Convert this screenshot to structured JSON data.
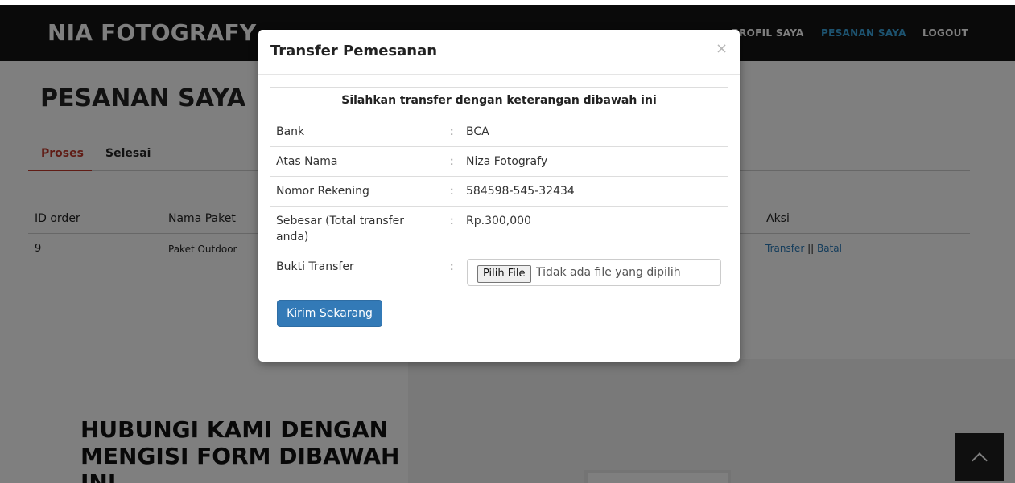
{
  "navbar": {
    "brand": "NIA FOTOGRAFY",
    "items": [
      "PROFIL SAYA",
      "PESANAN SAYA",
      "LOGOUT"
    ],
    "active_color": "#3aa6e0"
  },
  "page": {
    "title": "PESANAN SAYA",
    "tabs": [
      "Proses",
      "Selesai"
    ],
    "table": {
      "headers": [
        "ID order",
        "Nama Paket",
        "Aksi"
      ],
      "rows": [
        {
          "id": "9",
          "package": "Paket Outdoor",
          "action_transfer": "Transfer",
          "action_sep": "||",
          "action_cancel": "Batal"
        }
      ]
    }
  },
  "contact": {
    "title": "HUBUNGI KAMI DENGAN MENGISI FORM DIBAWAH INI"
  },
  "modal": {
    "title": "Transfer Pemesanan",
    "close": "×",
    "heading": "Silahkan transfer dengan keterangan dibawah ini",
    "rows": [
      {
        "label": "Bank",
        "value": "BCA"
      },
      {
        "label": "Atas Nama",
        "value": "Niza Fotografy"
      },
      {
        "label": "Nomor Rekening",
        "value": "584598-545-32434"
      },
      {
        "label": "Sebesar (Total transfer anda)",
        "value": "Rp.300,000"
      },
      {
        "label": "Bukti Transfer",
        "value": ""
      }
    ],
    "colon": ":",
    "file_button": "Pilih File",
    "file_status": "Tidak ada file yang dipilih",
    "submit": "Kirim Sekarang",
    "accent": "#337ab7"
  },
  "scroll_top": {
    "icon": "chevron-up-icon"
  }
}
